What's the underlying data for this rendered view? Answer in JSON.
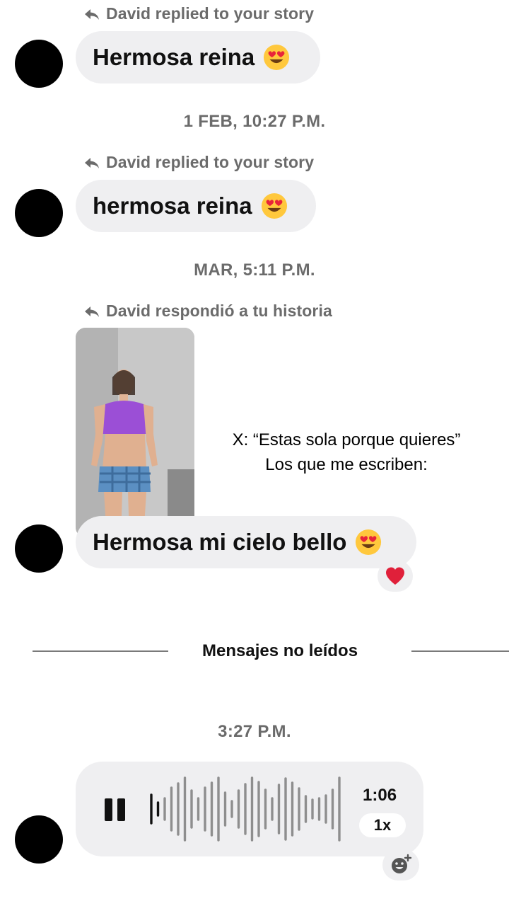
{
  "messages": {
    "m1": {
      "reply_label": "David replied to your story",
      "text": "Hermosa reina"
    },
    "ts1": "1 FEB, 10:27 P.M.",
    "m2": {
      "reply_label": "David replied to your story",
      "text": "hermosa reina"
    },
    "ts2": "MAR, 5:11 P.M.",
    "m3": {
      "reply_label": "David respondió a tu historia",
      "text": "Hermosa mi cielo bello"
    },
    "divider": "Mensajes no leídos",
    "ts3": "3:27 P.M.",
    "audio": {
      "duration": "1:06",
      "speed": "1x"
    }
  },
  "overlay": {
    "line1": "X: “Estas sola porque quieres”",
    "line2": "Los que me escriben:"
  },
  "colors": {
    "bubble": "#efeff1",
    "muted_text": "#6b6b6b",
    "heart": "#e0203a"
  },
  "icons": {
    "reply": "reply-arrow-icon",
    "emoji": "heart-eyes-emoji-icon",
    "pause": "pause-icon",
    "reaction": "red-heart-icon",
    "add_reaction": "add-reaction-icon"
  }
}
